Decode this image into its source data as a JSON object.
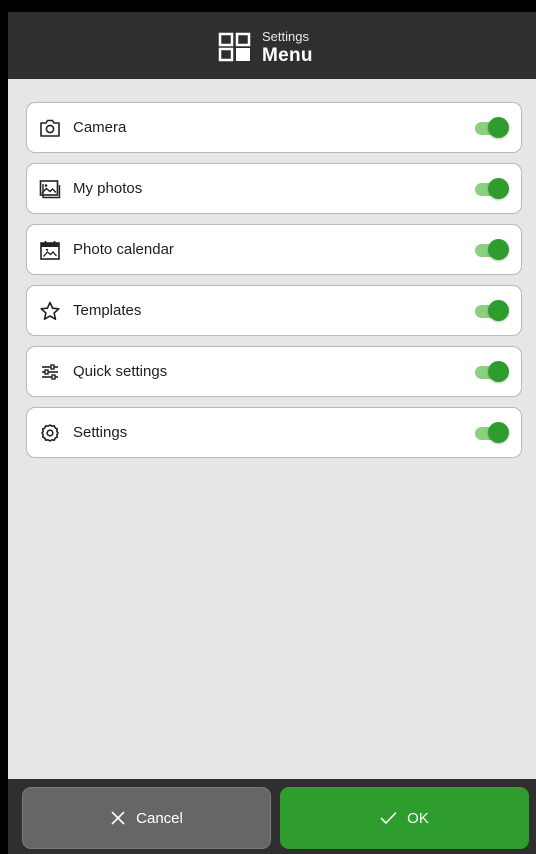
{
  "header": {
    "subtitle": "Settings",
    "title": "Menu",
    "icon": "grid-icon"
  },
  "items": [
    {
      "label": "Camera",
      "icon": "camera-icon",
      "enabled": true
    },
    {
      "label": "My photos",
      "icon": "photos-icon",
      "enabled": true
    },
    {
      "label": "Photo calendar",
      "icon": "calendar-icon",
      "enabled": true
    },
    {
      "label": "Templates",
      "icon": "star-icon",
      "enabled": true
    },
    {
      "label": "Quick settings",
      "icon": "sliders-icon",
      "enabled": true
    },
    {
      "label": "Settings",
      "icon": "gear-icon",
      "enabled": true
    }
  ],
  "footer": {
    "cancel_label": "Cancel",
    "ok_label": "OK"
  },
  "colors": {
    "header_bg": "#2f2f2f",
    "content_bg": "#e6e6e6",
    "accent_green": "#2e9d2e",
    "toggle_track": "#8bcf7f",
    "cancel_bg": "#666666"
  }
}
